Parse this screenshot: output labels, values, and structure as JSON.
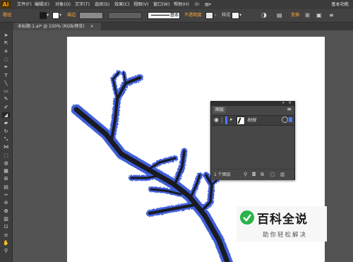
{
  "app": {
    "logo": "Ai",
    "workspace": "基本功能"
  },
  "menu": [
    "文件(F)",
    "编辑(E)",
    "对象(O)",
    "文字(T)",
    "选择(S)",
    "效果(C)",
    "视图(V)",
    "窗口(W)",
    "帮助(H)"
  ],
  "control": {
    "selection_label": "路径",
    "stroke_label": "描边",
    "brush_label": "基本",
    "opacity_label": "不透明度",
    "style_label": "样式",
    "transform_label": "变换"
  },
  "document": {
    "tab_title": "未标题-1.ai* @ 150% (RGB/预览)",
    "close_glyph": "×"
  },
  "layers_panel": {
    "tab_label": "图层",
    "layer_name": "树枝",
    "footer_count": "1 个图层",
    "collapse_glyph": "»",
    "close_glyph": "×",
    "menu_glyph": "≡"
  },
  "watermark": {
    "title": "百科全说",
    "subtitle": "助你轻松解决"
  },
  "colors": {
    "accent_orange": "#ff9a00",
    "branch_dark": "#1a1a22",
    "selection_blue": "#3f5fd9",
    "panel_bg": "#474747",
    "app_bg": "#535353"
  }
}
